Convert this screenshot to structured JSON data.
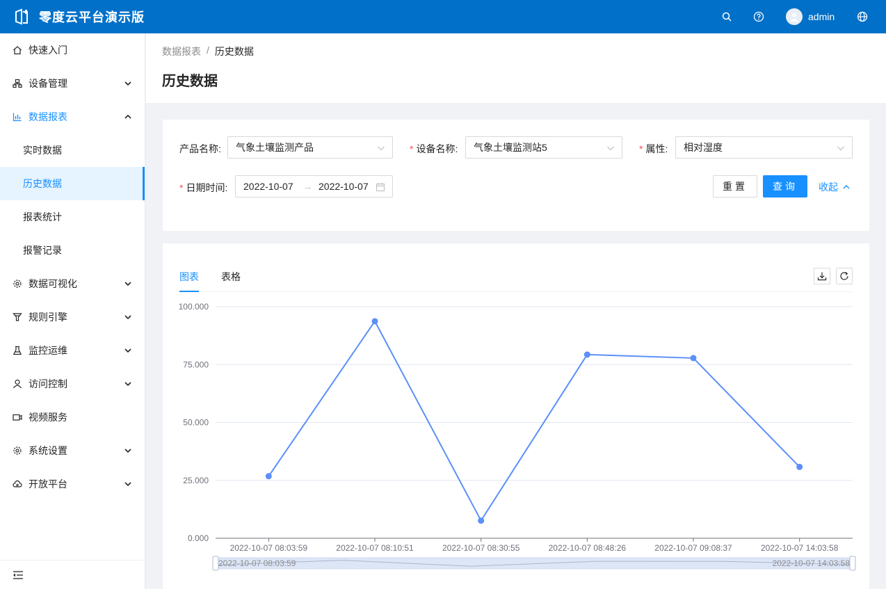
{
  "header": {
    "app_title": "零度云平台演示版",
    "username": "admin",
    "icons": [
      "logo-icon",
      "search-icon",
      "help-icon",
      "avatar-icon",
      "globe-icon"
    ]
  },
  "sidebar": {
    "items": [
      {
        "label": "快速入门",
        "icon": "home-icon"
      },
      {
        "label": "设备管理",
        "icon": "devices-icon",
        "chevron": "down"
      },
      {
        "label": "数据报表",
        "icon": "chart-icon",
        "chevron": "up",
        "open": true
      },
      {
        "label": "数据可视化",
        "icon": "gear-icon",
        "chevron": "down"
      },
      {
        "label": "规则引擎",
        "icon": "filter-icon",
        "chevron": "down"
      },
      {
        "label": "监控运维",
        "icon": "flask-icon",
        "chevron": "down"
      },
      {
        "label": "访问控制",
        "icon": "user-icon",
        "chevron": "down"
      },
      {
        "label": "视频服务",
        "icon": "video-icon"
      },
      {
        "label": "系统设置",
        "icon": "settings-icon",
        "chevron": "down"
      },
      {
        "label": "开放平台",
        "icon": "cloud-icon",
        "chevron": "down"
      }
    ],
    "subitems": [
      {
        "label": "实时数据"
      },
      {
        "label": "历史数据",
        "active": true
      },
      {
        "label": "报表统计"
      },
      {
        "label": "报警记录"
      }
    ]
  },
  "breadcrumb": {
    "parent": "数据报表",
    "separator": "/",
    "current": "历史数据"
  },
  "page_title": "历史数据",
  "filters": {
    "product_label": "产品名称:",
    "product_value": "气象土壤监测产品",
    "device_label": "设备名称:",
    "device_value": "气象土壤监测站5",
    "attr_label": "属性:",
    "attr_value": "相对湿度",
    "date_label": "日期时间:",
    "date_start": "2022-10-07",
    "date_end": "2022-10-07",
    "reset_label": "重置",
    "query_label": "查询",
    "collapse_label": "收起",
    "required_mark": "*"
  },
  "tabs": {
    "chart": "图表",
    "table": "表格"
  },
  "colors": {
    "primary": "#1890ff",
    "header_bg": "#0070c8",
    "line": "#5b8ff9"
  },
  "chart_data": {
    "type": "line",
    "x": [
      "2022-10-07 08:03:59",
      "2022-10-07 08:10:51",
      "2022-10-07 08:30:55",
      "2022-10-07 08:48:26",
      "2022-10-07 09:08:37",
      "2022-10-07 14:03:58"
    ],
    "series": [
      {
        "values": [
          26.8,
          93.7,
          7.6,
          79.3,
          77.8,
          30.8
        ]
      }
    ],
    "yticks": [
      "0.000",
      "25.000",
      "50.000",
      "75.000",
      "100.000"
    ],
    "ylim": [
      0,
      100
    ],
    "grid": true,
    "datazoom": {
      "start_label": "2022-10-07 08:03:59",
      "end_label": "2022-10-07 14:03:58"
    }
  }
}
